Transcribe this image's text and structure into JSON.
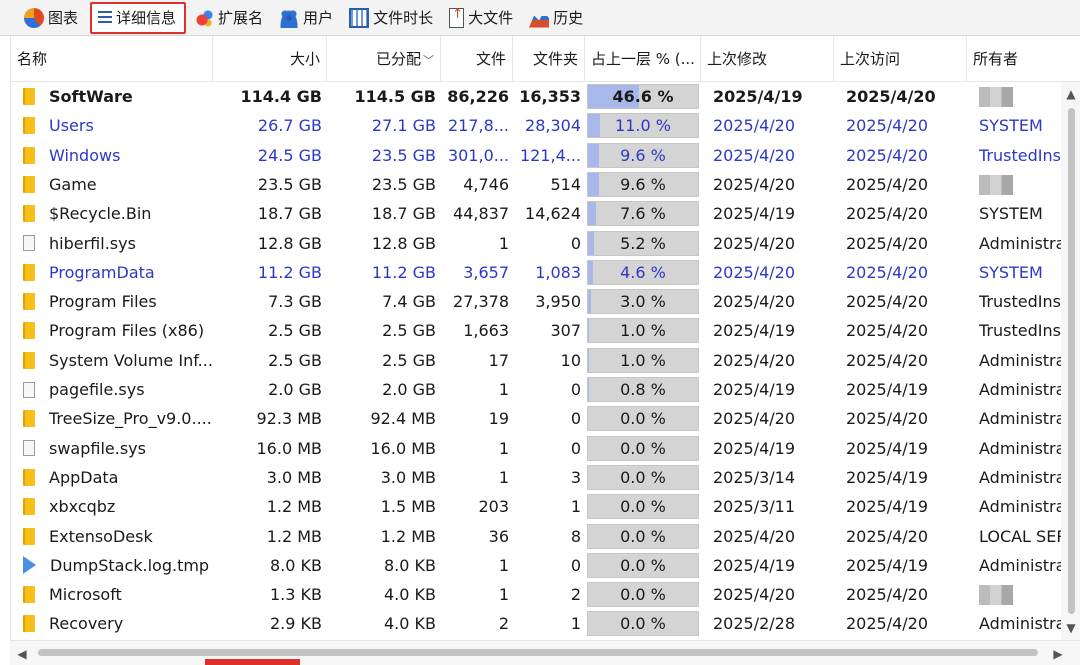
{
  "tabs": [
    {
      "label": "图表",
      "icon": "pie-chart-icon"
    },
    {
      "label": "详细信息",
      "icon": "details-list-icon",
      "active": true
    },
    {
      "label": "扩展名",
      "icon": "extensions-icon"
    },
    {
      "label": "用户",
      "icon": "users-icon"
    },
    {
      "label": "文件时长",
      "icon": "calendar-icon"
    },
    {
      "label": "大文件",
      "icon": "large-file-icon"
    },
    {
      "label": "历史",
      "icon": "history-icon"
    }
  ],
  "columns": {
    "name": "名称",
    "size": "大小",
    "allocated": "已分配",
    "files": "文件",
    "folders": "文件夹",
    "percent": "占上一层 % (...",
    "modified": "上次修改",
    "accessed": "上次访问",
    "owner": "所有者"
  },
  "rows": [
    {
      "name": "SoftWare",
      "type": "folder",
      "size": "114.4 GB",
      "allocated": "114.5 GB",
      "files": "86,226",
      "folders": "16,353",
      "pct_text": "46.6 %",
      "pct": 46.6,
      "modified": "2025/4/19",
      "accessed": "2025/4/20",
      "owner": "",
      "style": "bold"
    },
    {
      "name": "Users",
      "type": "folder",
      "size": "26.7 GB",
      "allocated": "27.1 GB",
      "files": "217,8...",
      "folders": "28,304",
      "pct_text": "11.0 %",
      "pct": 11.0,
      "modified": "2025/4/20",
      "accessed": "2025/4/20",
      "owner": "SYSTEM",
      "style": "blue"
    },
    {
      "name": "Windows",
      "type": "folder",
      "size": "24.5 GB",
      "allocated": "23.5 GB",
      "files": "301,0...",
      "folders": "121,4...",
      "pct_text": "9.6 %",
      "pct": 9.6,
      "modified": "2025/4/20",
      "accessed": "2025/4/20",
      "owner": "TrustedInstaller",
      "style": "blue"
    },
    {
      "name": "Game",
      "type": "folder",
      "size": "23.5 GB",
      "allocated": "23.5 GB",
      "files": "4,746",
      "folders": "514",
      "pct_text": "9.6 %",
      "pct": 9.6,
      "modified": "2025/4/20",
      "accessed": "2025/4/20",
      "owner": "",
      "style": ""
    },
    {
      "name": "$Recycle.Bin",
      "type": "folder",
      "size": "18.7 GB",
      "allocated": "18.7 GB",
      "files": "44,837",
      "folders": "14,624",
      "pct_text": "7.6 %",
      "pct": 7.6,
      "modified": "2025/4/19",
      "accessed": "2025/4/20",
      "owner": "SYSTEM",
      "style": ""
    },
    {
      "name": "hiberfil.sys",
      "type": "file",
      "size": "12.8 GB",
      "allocated": "12.8 GB",
      "files": "1",
      "folders": "0",
      "pct_text": "5.2 %",
      "pct": 5.2,
      "modified": "2025/4/20",
      "accessed": "2025/4/20",
      "owner": "Administrators",
      "style": ""
    },
    {
      "name": "ProgramData",
      "type": "folder",
      "size": "11.2 GB",
      "allocated": "11.2 GB",
      "files": "3,657",
      "folders": "1,083",
      "pct_text": "4.6 %",
      "pct": 4.6,
      "modified": "2025/4/20",
      "accessed": "2025/4/20",
      "owner": "SYSTEM",
      "style": "blue"
    },
    {
      "name": "Program Files",
      "type": "folder",
      "size": "7.3 GB",
      "allocated": "7.4 GB",
      "files": "27,378",
      "folders": "3,950",
      "pct_text": "3.0 %",
      "pct": 3.0,
      "modified": "2025/4/20",
      "accessed": "2025/4/20",
      "owner": "TrustedInstaller",
      "style": ""
    },
    {
      "name": "Program Files (x86)",
      "type": "folder",
      "size": "2.5 GB",
      "allocated": "2.5 GB",
      "files": "1,663",
      "folders": "307",
      "pct_text": "1.0 %",
      "pct": 1.0,
      "modified": "2025/4/19",
      "accessed": "2025/4/20",
      "owner": "TrustedInstaller",
      "style": ""
    },
    {
      "name": "System Volume Inf...",
      "type": "folder",
      "size": "2.5 GB",
      "allocated": "2.5 GB",
      "files": "17",
      "folders": "10",
      "pct_text": "1.0 %",
      "pct": 1.0,
      "modified": "2025/4/20",
      "accessed": "2025/4/20",
      "owner": "Administrators",
      "style": ""
    },
    {
      "name": "pagefile.sys",
      "type": "file",
      "size": "2.0 GB",
      "allocated": "2.0 GB",
      "files": "1",
      "folders": "0",
      "pct_text": "0.8 %",
      "pct": 0.8,
      "modified": "2025/4/19",
      "accessed": "2025/4/19",
      "owner": "Administrators",
      "style": ""
    },
    {
      "name": "TreeSize_Pro_v9.0....",
      "type": "folder",
      "size": "92.3 MB",
      "allocated": "92.4 MB",
      "files": "19",
      "folders": "0",
      "pct_text": "0.0 %",
      "pct": 0.0,
      "modified": "2025/4/20",
      "accessed": "2025/4/20",
      "owner": "Administrators",
      "style": ""
    },
    {
      "name": "swapfile.sys",
      "type": "file",
      "size": "16.0 MB",
      "allocated": "16.0 MB",
      "files": "1",
      "folders": "0",
      "pct_text": "0.0 %",
      "pct": 0.0,
      "modified": "2025/4/19",
      "accessed": "2025/4/19",
      "owner": "Administrators",
      "style": ""
    },
    {
      "name": "AppData",
      "type": "folder",
      "size": "3.0 MB",
      "allocated": "3.0 MB",
      "files": "1",
      "folders": "3",
      "pct_text": "0.0 %",
      "pct": 0.0,
      "modified": "2025/3/14",
      "accessed": "2025/4/19",
      "owner": "Administrators",
      "style": ""
    },
    {
      "name": "xbxcqbz",
      "type": "folder",
      "size": "1.2 MB",
      "allocated": "1.5 MB",
      "files": "203",
      "folders": "1",
      "pct_text": "0.0 %",
      "pct": 0.0,
      "modified": "2025/3/11",
      "accessed": "2025/4/19",
      "owner": "Administrators",
      "style": ""
    },
    {
      "name": "ExtensoDesk",
      "type": "folder",
      "size": "1.2 MB",
      "allocated": "1.2 MB",
      "files": "36",
      "folders": "8",
      "pct_text": "0.0 %",
      "pct": 0.0,
      "modified": "2025/4/20",
      "accessed": "2025/4/20",
      "owner": "LOCAL SERVICE",
      "style": ""
    },
    {
      "name": "DumpStack.log.tmp",
      "type": "tmp",
      "size": "8.0 KB",
      "allocated": "8.0 KB",
      "files": "1",
      "folders": "0",
      "pct_text": "0.0 %",
      "pct": 0.0,
      "modified": "2025/4/19",
      "accessed": "2025/4/19",
      "owner": "Administrators",
      "style": ""
    },
    {
      "name": "Microsoft",
      "type": "folder",
      "size": "1.3 KB",
      "allocated": "4.0 KB",
      "files": "1",
      "folders": "2",
      "pct_text": "0.0 %",
      "pct": 0.0,
      "modified": "2025/4/20",
      "accessed": "2025/4/20",
      "owner": "",
      "style": ""
    },
    {
      "name": "Recovery",
      "type": "folder",
      "size": "2.9 KB",
      "allocated": "4.0 KB",
      "files": "2",
      "folders": "1",
      "pct_text": "0.0 %",
      "pct": 0.0,
      "modified": "2025/2/28",
      "accessed": "2025/4/20",
      "owner": "Administrators",
      "style": ""
    }
  ],
  "colors": {
    "accent_fill": "#a9b8ea",
    "link_blue": "#2b39c6",
    "highlight_red": "#e0302c"
  }
}
